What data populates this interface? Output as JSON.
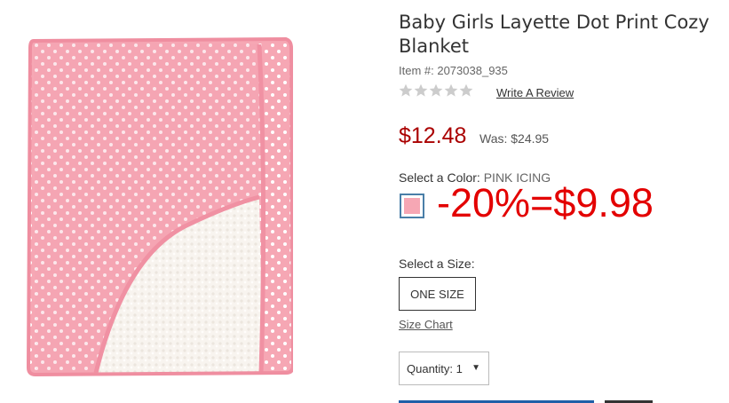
{
  "product": {
    "title": "Baby Girls Layette Dot Print Cozy Blanket",
    "item_number": "Item #: 2073038_935",
    "rating_stars": 0,
    "rating_max": 5,
    "write_review": "Write A Review",
    "price": "$12.48",
    "was_label": "Was:",
    "was_price": "$24.95",
    "color_label": "Select a Color:",
    "color_value": "PINK ICING",
    "swatch_color": "#f6a7b4",
    "promo_text": "-20%=$9.98",
    "size_label": "Select a Size:",
    "size_option": "ONE SIZE",
    "size_chart": "Size Chart",
    "quantity_label": "Quantity:",
    "quantity_value": "1"
  },
  "colors": {
    "price": "#aa0000",
    "promo": "#e30000",
    "blanket_pink": "#f6a7b4",
    "sherpa": "#faf6f2",
    "button_bar": "#1f5fa8"
  }
}
